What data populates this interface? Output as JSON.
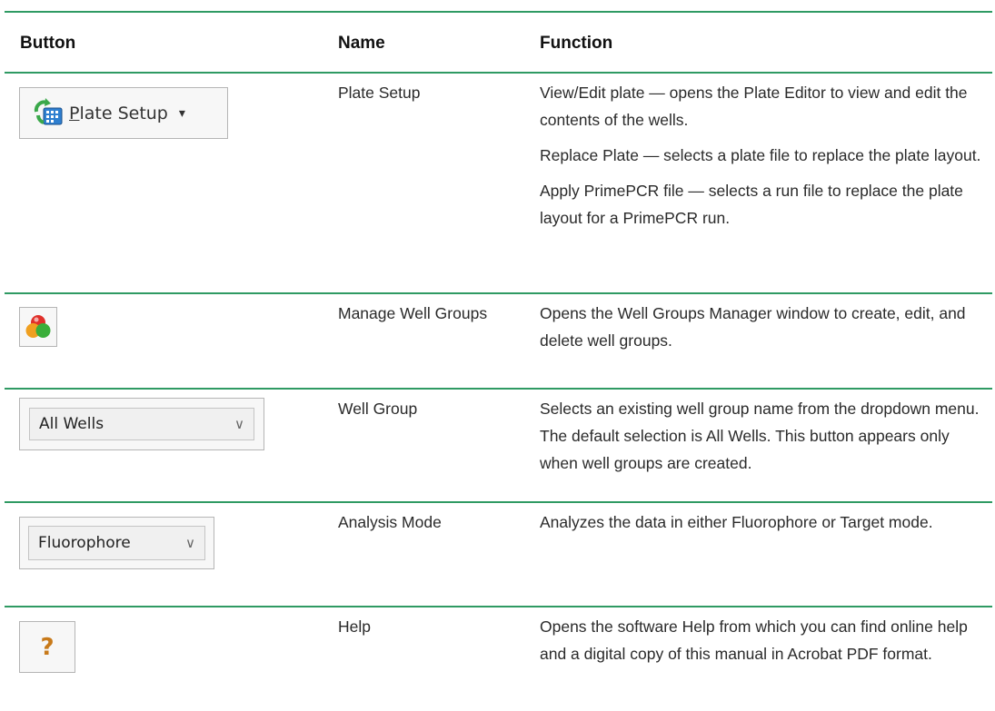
{
  "table": {
    "headers": {
      "button": "Button",
      "name": "Name",
      "function": "Function"
    },
    "rows": [
      {
        "button_label": "Plate Setup",
        "button_access_key": "P",
        "button_label_rest": "late Setup",
        "button_icon": "plate-setup-icon",
        "dropdown_arrow": "▾",
        "name": "Plate Setup",
        "function": [
          "View/Edit plate — opens the Plate Editor to view and edit the contents of the wells.",
          "Replace Plate — selects a plate file to replace the plate layout.",
          "Apply PrimePCR file — selects a run file to replace the plate layout for a PrimePCR run."
        ]
      },
      {
        "button_icon": "manage-well-groups-icon",
        "name": "Manage Well Groups",
        "function": [
          "Opens the Well Groups Manager window to create, edit, and delete well groups."
        ]
      },
      {
        "button_value": "All Wells",
        "button_icon": "chevron-down-icon",
        "dropdown_arrow": "∨",
        "name": "Well Group",
        "function": [
          "Selects an existing well group name from the dropdown menu. The default selection is All Wells. This button appears only when well groups are created."
        ]
      },
      {
        "button_value": "Fluorophore",
        "button_icon": "chevron-down-icon",
        "dropdown_arrow": "∨",
        "name": "Analysis Mode",
        "function": [
          "Analyzes the data in either Fluorophore or Target mode."
        ]
      },
      {
        "button_icon": "help-icon",
        "button_glyph": "?",
        "name": "Help",
        "function": [
          "Opens the software Help from which you can find online help and a digital copy of this manual in Acrobat PDF format."
        ]
      }
    ]
  },
  "colors": {
    "rule": "#2f9a63",
    "button_border": "#b5b5b5",
    "help_glyph": "#c87a1a"
  }
}
